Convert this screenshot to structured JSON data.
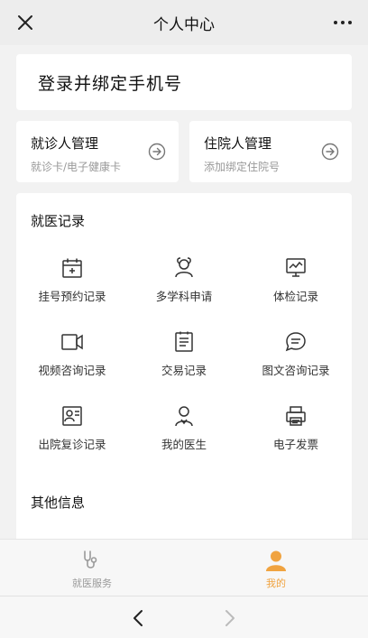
{
  "header": {
    "title": "个人中心"
  },
  "login": {
    "label": "登录并绑定手机号"
  },
  "management": [
    {
      "title": "就诊人管理",
      "subtitle": "就诊卡/电子健康卡"
    },
    {
      "title": "住院人管理",
      "subtitle": "添加绑定住院号"
    }
  ],
  "records": {
    "title": "就医记录",
    "items": [
      {
        "label": "挂号预约记录",
        "icon": "calendar-icon"
      },
      {
        "label": "多学科申请",
        "icon": "person-group-icon"
      },
      {
        "label": "体检记录",
        "icon": "monitor-chart-icon"
      },
      {
        "label": "视频咨询记录",
        "icon": "video-camera-icon"
      },
      {
        "label": "交易记录",
        "icon": "receipt-icon"
      },
      {
        "label": "图文咨询记录",
        "icon": "chat-bubble-icon"
      },
      {
        "label": "出院复诊记录",
        "icon": "id-card-icon"
      },
      {
        "label": "我的医生",
        "icon": "doctor-icon"
      },
      {
        "label": "电子发票",
        "icon": "printer-icon"
      }
    ]
  },
  "other": {
    "title": "其他信息"
  },
  "tabbar": {
    "tabs": [
      {
        "label": "就医服务",
        "icon": "stethoscope-icon",
        "active": false
      },
      {
        "label": "我的",
        "icon": "user-icon",
        "active": true
      }
    ]
  },
  "colors": {
    "accent": "#f0a340",
    "inactive": "#9a9a9a",
    "icon_stroke": "#333333"
  }
}
